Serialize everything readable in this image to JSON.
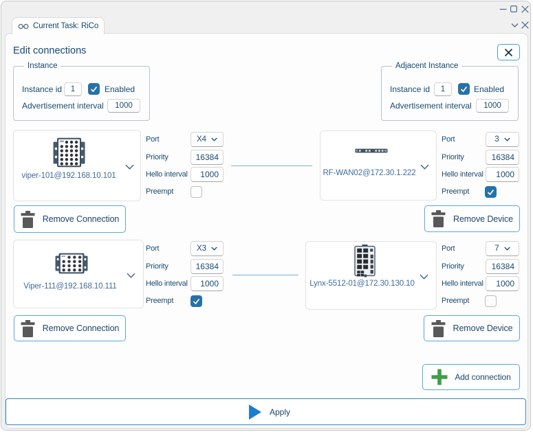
{
  "colors": {
    "accent_blue": "#1b7fd0",
    "checkbox_blue": "#2672a8",
    "button_border_blue": "#58a8dc",
    "apply_border_blue": "#2e86c0",
    "green_plus": "#3f9e46",
    "text_navy": "#1a4971",
    "device_label_blue": "#3e6c9a",
    "connector_blue": "#7aadd6",
    "trash_gray": "#595959",
    "window_bg": "#f0f0f1"
  },
  "titlebar": {
    "icons": [
      "minimize-icon",
      "maximize-icon",
      "close-icon"
    ]
  },
  "tabstrip": {
    "tab": {
      "icon": "link-icon",
      "label": "Current Task: RiCo"
    },
    "icons": [
      "chevron-down-icon",
      "close-icon"
    ]
  },
  "dialog": {
    "title": "Edit connections",
    "close_icon": "close-icon",
    "instance_group": {
      "legend": "Instance",
      "instance_id_label": "Instance id",
      "instance_id_value": "1",
      "enabled_label": "Enabled",
      "enabled_checked": true,
      "advertisement_label": "Advertisement interval",
      "advertisement_value": "1000"
    },
    "adjacent_group": {
      "legend": "Adjacent Instance",
      "instance_id_label": "Instance id",
      "instance_id_value": "1",
      "enabled_label": "Enabled",
      "enabled_checked": true,
      "advertisement_label": "Advertisement interval",
      "advertisement_value": "1000"
    },
    "field_labels": {
      "port": "Port",
      "priority": "Priority",
      "hello": "Hello interval",
      "preempt": "Preempt"
    },
    "connections": [
      {
        "left": {
          "device": "viper-101@192.168.10.101",
          "device_image": "viper-compact-switch",
          "port": "X4",
          "priority": "16384",
          "hello": "1000",
          "preempt": false,
          "remove_label": "Remove Connection"
        },
        "right": {
          "device": "RF-WAN02@172.30.1.222",
          "device_image": "rackmount-router",
          "port": "3",
          "priority": "16384",
          "hello": "1000",
          "preempt": true,
          "remove_label": "Remove Device"
        }
      },
      {
        "left": {
          "device": "Viper-111@192.168.10.111",
          "device_image": "viper-wide-switch",
          "port": "X3",
          "priority": "16384",
          "hello": "1000",
          "preempt": true,
          "remove_label": "Remove Connection"
        },
        "right": {
          "device": "Lynx-5512-01@172.30.130.10",
          "device_image": "lynx-din-rail-switch",
          "port": "7",
          "priority": "16384",
          "hello": "1000",
          "preempt": false,
          "remove_label": "Remove Device"
        }
      }
    ],
    "add_button_label": "Add connection",
    "apply_button_label": "Apply"
  }
}
